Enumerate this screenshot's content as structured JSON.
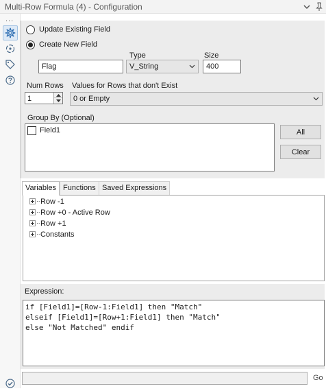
{
  "window": {
    "title": "Multi-Row Formula (4) - Configuration"
  },
  "rail": {
    "dots": "..."
  },
  "config": {
    "radio_update_label": "Update Existing Field",
    "radio_create_label": "Create New  Field",
    "selected_mode": "create",
    "type_label": "Type",
    "size_label": "Size",
    "field_name_value": "Flag",
    "type_value": "V_String",
    "size_value": "400",
    "num_rows_label": "Num Rows",
    "num_rows_value": "1",
    "nonexist_label": "Values for Rows that don't Exist",
    "nonexist_value": "0 or Empty",
    "group_by_label": "Group By (Optional)",
    "group_by_fields": [
      {
        "label": "Field1",
        "checked": false
      }
    ],
    "all_button": "All",
    "clear_button": "Clear"
  },
  "tabs": [
    {
      "label": "Variables",
      "active": true
    },
    {
      "label": "Functions",
      "active": false
    },
    {
      "label": "Saved Expressions",
      "active": false
    }
  ],
  "tree": {
    "items": [
      "Row -1",
      "Row +0 - Active Row",
      "Row +1",
      "Constants"
    ]
  },
  "expression": {
    "label": "Expression:",
    "lines": [
      "if [Field1]=[Row-1:Field1] then \"Match\"",
      "elseif [Field1]=[Row+1:Field1] then \"Match\"",
      "else \"Not Matched\" endif"
    ]
  },
  "bottom": {
    "go_label": "Go",
    "input_value": ""
  },
  "colors": {
    "panel_bg": "#ececec",
    "active_rail_bg": "#dde9f6"
  }
}
